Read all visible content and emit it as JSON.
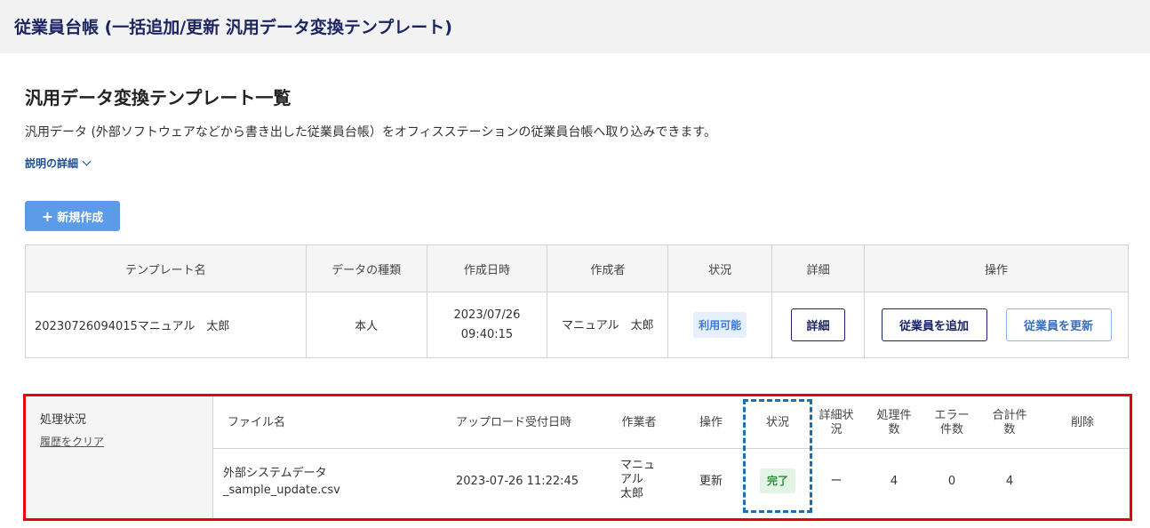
{
  "header": {
    "title": "従業員台帳 (一括追加/更新 汎用データ変換テンプレート)"
  },
  "page": {
    "title": "汎用データ変換テンプレート一覧",
    "description": "汎用データ (外部ソフトウェアなどから書き出した従業員台帳）をオフィスステーションの従業員台帳へ取り込みできます。",
    "detail_link": "説明の詳細",
    "new_button": "新規作成"
  },
  "template_table": {
    "headers": [
      "テンプレート名",
      "データの種類",
      "作成日時",
      "作成者",
      "状況",
      "詳細",
      "操作"
    ],
    "rows": [
      {
        "name": "20230726094015マニュアル　太郎",
        "type": "本人",
        "created_date": "2023/07/26",
        "created_time": "09:40:15",
        "creator": "マニュアル　太郎",
        "status": "利用可能",
        "detail_button": "詳細",
        "add_button": "従業員を追加",
        "update_button": "従業員を更新"
      }
    ]
  },
  "processing": {
    "label": "処理状況",
    "clear_history": "履歴をクリア",
    "headers": {
      "file_name": "ファイル名",
      "uploaded_at": "アップロード受付日時",
      "worker": "作業者",
      "operation": "操作",
      "status": "状況",
      "detail_status_1": "詳細状",
      "detail_status_2": "況",
      "processed_1": "処理件",
      "processed_2": "数",
      "errors_1": "エラー",
      "errors_2": "件数",
      "total_1": "合計件",
      "total_2": "数",
      "delete": "削除"
    },
    "rows": [
      {
        "file_name_1": "外部システムデータ",
        "file_name_2": "_sample_update.csv",
        "uploaded_at": "2023-07-26 11:22:45",
        "worker_1": "マニュ",
        "worker_2": "アル",
        "worker_3": "太郎",
        "operation": "更新",
        "status": "完了",
        "detail_status": "ー",
        "processed": "4",
        "errors": "0",
        "total": "4"
      }
    ]
  }
}
